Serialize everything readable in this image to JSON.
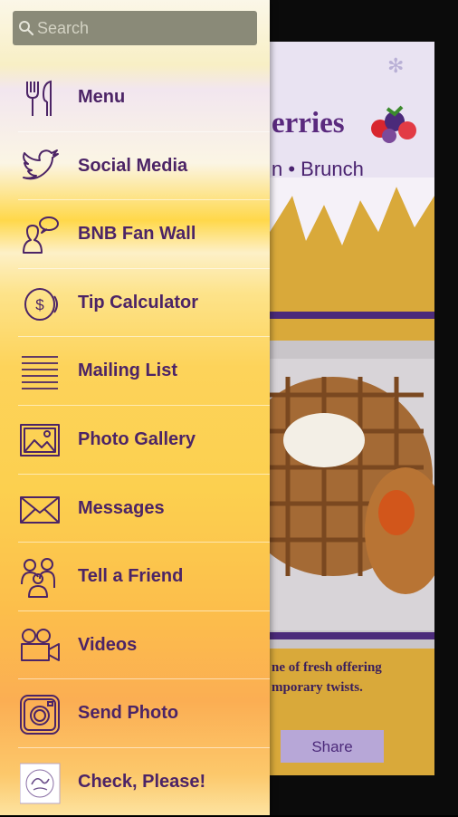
{
  "search": {
    "placeholder": "Search"
  },
  "menu": [
    {
      "label": "Menu",
      "icon": "fork-knife-icon"
    },
    {
      "label": "Social Media",
      "icon": "twitter-bird-icon"
    },
    {
      "label": "BNB Fan Wall",
      "icon": "fan-wall-speech-icon"
    },
    {
      "label": "Tip Calculator",
      "icon": "coin-dollar-icon"
    },
    {
      "label": "Mailing List",
      "icon": "list-lines-icon"
    },
    {
      "label": "Photo Gallery",
      "icon": "photo-icon"
    },
    {
      "label": "Messages",
      "icon": "envelope-icon"
    },
    {
      "label": "Tell a Friend",
      "icon": "people-icon"
    },
    {
      "label": "Videos",
      "icon": "video-camera-icon"
    },
    {
      "label": "Send Photo",
      "icon": "instagram-camera-icon"
    },
    {
      "label": "Check, Please!",
      "icon": "check-please-logo-icon"
    }
  ],
  "background": {
    "logo_text": "erries",
    "subtitle": "n • Brunch",
    "tagline_line1": "ne of fresh offering",
    "tagline_line2": "mporary twists.",
    "share_label": "Share"
  },
  "colors": {
    "menu_text": "#4c2466",
    "search_bg": "#8a8a78",
    "accent_purple": "#5a2a7e",
    "share_bg": "#b7a7d7"
  }
}
